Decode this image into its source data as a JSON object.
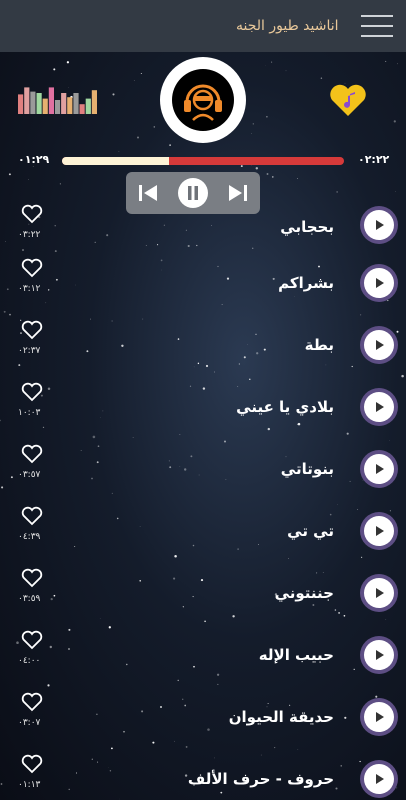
{
  "header": {
    "title": "اناشيد طيور الجنه"
  },
  "player": {
    "elapsed": "٠١:٢٩",
    "total": "٠٢:٢٢",
    "progress": 0.38,
    "accent_color": "#d63a3a",
    "fill_color": "#fdf3d6"
  },
  "equalizer": {
    "levels": [
      0.7,
      0.95,
      0.8,
      0.75,
      0.55,
      0.95,
      0.5,
      0.75,
      0.6,
      0.75,
      0.35,
      0.55,
      0.85
    ],
    "colors": [
      "#e08080",
      "#e0a0a0",
      "#9a9a9a",
      "#a0d8a0",
      "#e6b070",
      "#e070a0",
      "#9a9a9a",
      "#e0a0a0",
      "#e6b070",
      "#9a9a9a",
      "#e08080",
      "#a0d8a0",
      "#e6b070"
    ]
  },
  "controls": {
    "prev": "previous-icon",
    "pause": "pause-icon",
    "next": "next-icon"
  },
  "tracks": [
    {
      "title": "بحجابي",
      "duration": "٠٣:٢٢"
    },
    {
      "title": "بشراكم",
      "duration": "٠٣:١٢"
    },
    {
      "title": "بطة",
      "duration": "٠٢:٣٧"
    },
    {
      "title": "بلادي يا عيني",
      "duration": "١٠:٠٣"
    },
    {
      "title": "بنوتاتي",
      "duration": "٠٣:٥٧"
    },
    {
      "title": "تي تي",
      "duration": "٠٤:٣٩"
    },
    {
      "title": "جننتوني",
      "duration": "٠٣:٥٩"
    },
    {
      "title": "حبيب الإله",
      "duration": "٠٤:٠٠"
    },
    {
      "title": "حديقة الحيوان",
      "duration": "٠٣:٠٧"
    },
    {
      "title": "حروف - حرف الألف",
      "duration": "٠١:١٣"
    }
  ]
}
